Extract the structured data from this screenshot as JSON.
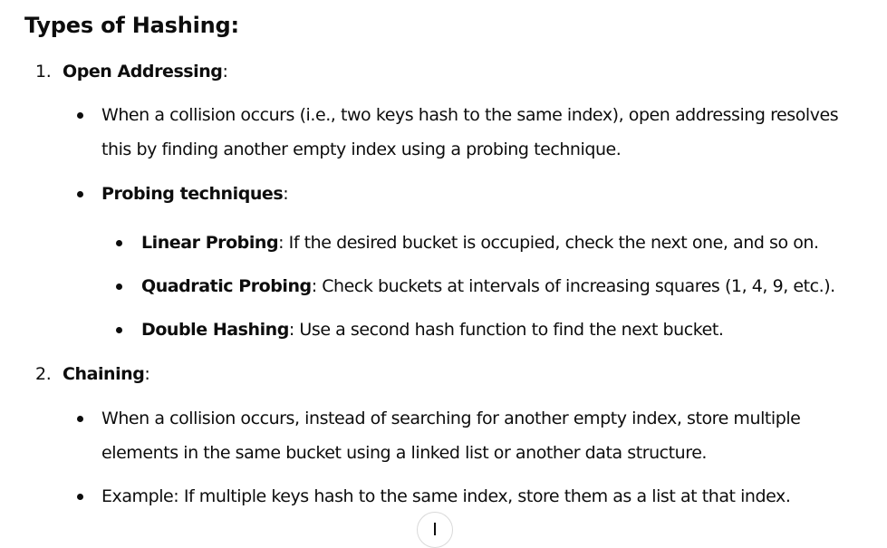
{
  "heading": "Types of Hashing:",
  "sections": [
    {
      "number": "1.",
      "title": "Open Addressing",
      "suffix": ":",
      "items": [
        {
          "lines": [
            "When a collision occurs (i.e., two keys hash to the same index), open addressing resolves",
            "this by finding another empty index using a probing technique."
          ]
        },
        {
          "title": "Probing techniques",
          "suffix": ":",
          "subitems": [
            {
              "title": "Linear Probing",
              "text": ": If the desired bucket is occupied, check the next one, and so on."
            },
            {
              "title": "Quadratic Probing",
              "text": ": Check buckets at intervals of increasing squares (1, 4, 9, etc.)."
            },
            {
              "title": "Double Hashing",
              "text": ": Use a second hash function to find the next bucket."
            }
          ]
        }
      ]
    },
    {
      "number": "2.",
      "title": "Chaining",
      "suffix": ":",
      "items": [
        {
          "lines": [
            "When a collision occurs, instead of searching for another empty index, store multiple",
            "elements in the same bucket using a linked list or another data structure."
          ]
        },
        {
          "lines": [
            "Example: If multiple keys hash to the same index, store them as a list at that index."
          ]
        }
      ]
    }
  ],
  "scroll_button": {
    "icon": "arrow-down-icon"
  }
}
